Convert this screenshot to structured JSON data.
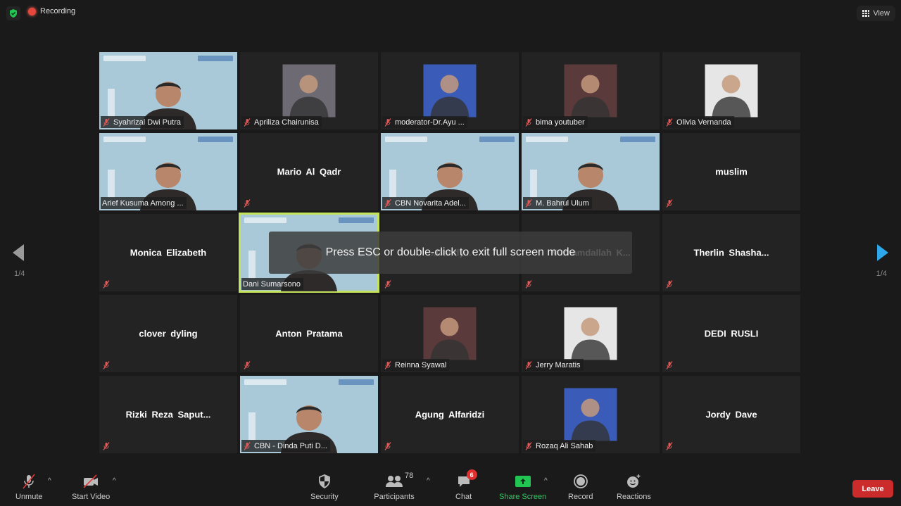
{
  "topbar": {
    "security_status_icon": "shield-check-icon",
    "recording_label": "Recording",
    "view_label": "View"
  },
  "overlay": {
    "message": "Press ESC or double-click to exit full screen mode"
  },
  "pagination": {
    "left_indicator": "1/4",
    "right_indicator": "1/4"
  },
  "colors": {
    "accent_blue": "#2ea8ea",
    "active_speaker": "#c4e35a",
    "share_green": "#2dcc5a",
    "leave_red": "#cc2b2b",
    "recording_red": "#e8473d"
  },
  "participants": [
    {
      "name": "Syahrizal Dwi Putra",
      "type": "video",
      "muted": true
    },
    {
      "name": "Apriliza Chairunisa",
      "type": "photo",
      "muted": true
    },
    {
      "name": "moderator-Dr.Ayu ...",
      "type": "photo",
      "muted": true
    },
    {
      "name": "bima youtuber",
      "type": "photo",
      "muted": true
    },
    {
      "name": "Olivia Vernanda",
      "type": "photo",
      "muted": true
    },
    {
      "name": "Arief Kusuma Among ...",
      "type": "video",
      "muted": false
    },
    {
      "name": "Mario Al Qadr",
      "type": "name",
      "muted": true
    },
    {
      "name": "CBN Novarita Adel...",
      "type": "video",
      "muted": true
    },
    {
      "name": "M. Bahrul Ulum",
      "type": "video",
      "muted": true
    },
    {
      "name": "muslim",
      "type": "name",
      "muted": true
    },
    {
      "name": "Monica Elizabeth",
      "type": "name",
      "muted": true
    },
    {
      "name": "Dani Sumarsono",
      "type": "video",
      "muted": false,
      "active": true
    },
    {
      "name": "...Gandy...",
      "type": "name",
      "muted": true
    },
    {
      "name": "Nurhamdallah K...",
      "type": "name",
      "muted": true
    },
    {
      "name": "Therlin Shasha...",
      "type": "name",
      "muted": true
    },
    {
      "name": "clover dyling",
      "type": "name",
      "muted": true
    },
    {
      "name": "Anton Pratama",
      "type": "name",
      "muted": true
    },
    {
      "name": "Reinna Syawal",
      "type": "photo",
      "muted": true
    },
    {
      "name": "Jerry Maratis",
      "type": "photo",
      "muted": true
    },
    {
      "name": "DEDI RUSLI",
      "type": "name",
      "muted": true
    },
    {
      "name": "Rizki Reza Saput...",
      "type": "name",
      "muted": true
    },
    {
      "name": "CBN - Dinda Puti D...",
      "type": "video",
      "muted": true
    },
    {
      "name": "Agung Alfaridzi",
      "type": "name",
      "muted": true
    },
    {
      "name": "Rozaq Ali Sahab",
      "type": "photo",
      "muted": true
    },
    {
      "name": "Jordy Dave",
      "type": "name",
      "muted": true
    }
  ],
  "toolbar": {
    "unmute_label": "Unmute",
    "start_video_label": "Start Video",
    "security_label": "Security",
    "participants_label": "Participants",
    "participants_count": "78",
    "chat_label": "Chat",
    "chat_badge": "6",
    "share_screen_label": "Share Screen",
    "record_label": "Record",
    "reactions_label": "Reactions",
    "leave_label": "Leave"
  }
}
